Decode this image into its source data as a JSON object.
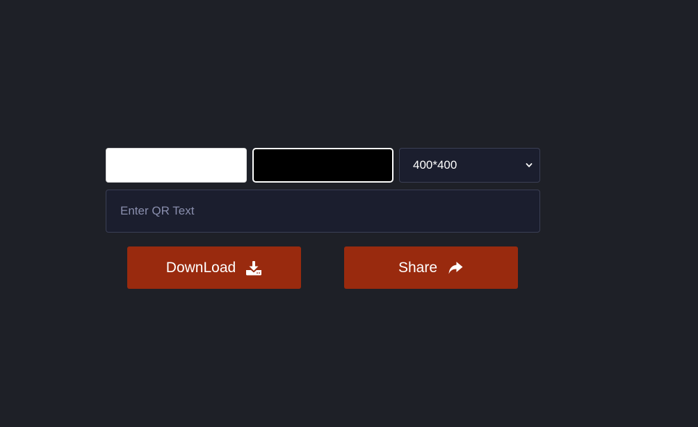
{
  "controls": {
    "background_color": "#ffffff",
    "foreground_color": "#000000",
    "size_select": {
      "selected": "400*400"
    },
    "qr_text": {
      "value": "",
      "placeholder": "Enter QR Text"
    }
  },
  "actions": {
    "download_label": "DownLoad",
    "download_icon": "download-icon",
    "share_label": "Share",
    "share_icon": "share-icon"
  },
  "colors": {
    "page_background": "#1e2027",
    "field_background": "#1b1e2e",
    "button": "#992a0e",
    "placeholder": "#8a8fae"
  }
}
